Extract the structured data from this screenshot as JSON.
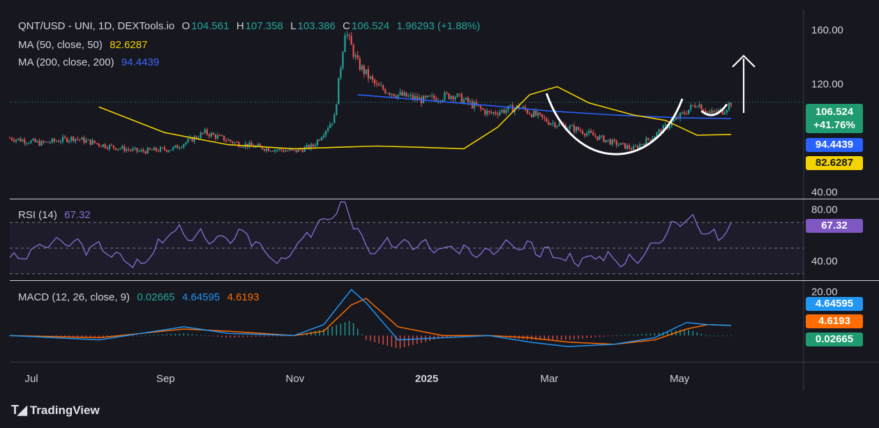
{
  "header": {
    "symbol": "QNT/USD - UNI, 1D, DEXTools.io",
    "o_label": "O",
    "o_value": "104.561",
    "h_label": "H",
    "h_value": "107.358",
    "l_label": "L",
    "l_value": "103.386",
    "c_label": "C",
    "c_value": "106.524",
    "change": "1.96293 (+1.88%)"
  },
  "ma50": {
    "label": "MA (50, close, 50)",
    "value": "82.6287",
    "color": "#f5d300"
  },
  "ma200": {
    "label": "MA (200, close, 200)",
    "value": "94.4439",
    "color": "#2962ff"
  },
  "rsi": {
    "label": "RSI (14)",
    "value": "67.32",
    "color": "#8b6fd6"
  },
  "macd": {
    "label": "MACD (12, 26, close, 9)",
    "hist_value": "0.02665",
    "macd_value": "4.64595",
    "signal_value": "4.6193"
  },
  "price_tags": {
    "price": "106.524",
    "price_change": "+41.76%",
    "ma200": "94.4439",
    "ma50": "82.6287"
  },
  "brand": "TradingView",
  "colors": {
    "background": "#16171f",
    "up": "#26a69a",
    "down": "#ef5350",
    "ma50": "#f5d300",
    "ma200": "#2962ff",
    "rsi": "#8b6fd6",
    "macd": "#2196f3",
    "signal": "#ff6d00"
  },
  "chart_data": [
    {
      "type": "line",
      "title": "QNT/USD - UNI, 1D, DEXTools.io",
      "x_ticks": [
        "Jul",
        "Sep",
        "Nov",
        "2025",
        "Mar",
        "May"
      ],
      "y_ticks": [
        "160.00",
        "120.00",
        "40.00"
      ],
      "ylim": [
        35,
        175
      ],
      "series": [
        {
          "name": "Close",
          "x": [
            "2024-06-20",
            "2024-07-05",
            "2024-07-20",
            "2024-08-05",
            "2024-08-20",
            "2024-09-05",
            "2024-09-20",
            "2024-10-05",
            "2024-10-20",
            "2024-11-01",
            "2024-11-10",
            "2024-11-20",
            "2024-11-25",
            "2024-12-01",
            "2024-12-10",
            "2024-12-20",
            "2025-01-01",
            "2025-01-15",
            "2025-02-01",
            "2025-02-15",
            "2025-03-01",
            "2025-03-15",
            "2025-04-01",
            "2025-04-10",
            "2025-04-20",
            "2025-05-01",
            "2025-05-10",
            "2025-05-16",
            "2025-05-22",
            "2025-05-26"
          ],
          "values": [
            80,
            76,
            80,
            74,
            70,
            72,
            84,
            76,
            72,
            70,
            74,
            95,
            160,
            135,
            118,
            112,
            108,
            112,
            98,
            103,
            92,
            86,
            76,
            72,
            82,
            95,
            106,
            98,
            100,
            106.5
          ]
        },
        {
          "name": "MA (50, close, 50)",
          "x": [
            "2024-08-01",
            "2024-09-01",
            "2024-10-01",
            "2024-11-01",
            "2024-11-20",
            "2024-12-10",
            "2025-01-01",
            "2025-01-20",
            "2025-02-05",
            "2025-02-20",
            "2025-03-05",
            "2025-03-20",
            "2025-04-10",
            "2025-04-25",
            "2025-05-10",
            "2025-05-26"
          ],
          "values": [
            103,
            84,
            75,
            72,
            73,
            74,
            73,
            72,
            88,
            112,
            118,
            106,
            97,
            93,
            82,
            82.6
          ]
        },
        {
          "name": "MA (200, close, 200)",
          "x": [
            "2024-12-01",
            "2025-01-01",
            "2025-02-01",
            "2025-03-01",
            "2025-04-01",
            "2025-05-01",
            "2025-05-26"
          ],
          "values": [
            112,
            108,
            104,
            100,
            97,
            95,
            94.4
          ]
        }
      ]
    },
    {
      "type": "line",
      "title": "RSI (14)",
      "y_ticks": [
        "80.00",
        "40.00"
      ],
      "ylim": [
        25,
        88
      ],
      "series": [
        {
          "name": "RSI (14)",
          "x": [
            "2024-06-20",
            "2024-07-10",
            "2024-08-01",
            "2024-08-20",
            "2024-09-05",
            "2024-09-25",
            "2024-10-10",
            "2024-10-25",
            "2024-11-10",
            "2024-11-20",
            "2024-11-25",
            "2024-12-05",
            "2024-12-20",
            "2025-01-10",
            "2025-02-01",
            "2025-02-20",
            "2025-03-10",
            "2025-03-25",
            "2025-04-10",
            "2025-04-25",
            "2025-05-05",
            "2025-05-15",
            "2025-05-20",
            "2025-05-26"
          ],
          "values": [
            40,
            55,
            50,
            35,
            65,
            55,
            60,
            38,
            65,
            78,
            85,
            50,
            55,
            50,
            48,
            52,
            40,
            45,
            38,
            62,
            75,
            60,
            58,
            67.32
          ]
        }
      ]
    },
    {
      "type": "line",
      "title": "MACD (12, 26, close, 9)",
      "y_ticks": [
        "20.00"
      ],
      "ylim": [
        -12,
        25
      ],
      "series": [
        {
          "name": "MACD",
          "x": [
            "2024-06-20",
            "2024-08-01",
            "2024-09-10",
            "2024-10-01",
            "2024-11-01",
            "2024-11-15",
            "2024-11-28",
            "2024-12-05",
            "2024-12-20",
            "2025-01-10",
            "2025-02-01",
            "2025-02-20",
            "2025-03-10",
            "2025-04-01",
            "2025-04-20",
            "2025-05-05",
            "2025-05-15",
            "2025-05-26"
          ],
          "values": [
            0,
            -2,
            4,
            1,
            0,
            5,
            21,
            15,
            -2,
            -1,
            0,
            -3,
            -5,
            -4,
            -1,
            6,
            5,
            4.64595
          ]
        },
        {
          "name": "Signal",
          "x": [
            "2024-06-20",
            "2024-08-01",
            "2024-09-10",
            "2024-10-01",
            "2024-11-01",
            "2024-11-15",
            "2024-11-28",
            "2024-12-05",
            "2024-12-20",
            "2025-01-10",
            "2025-02-01",
            "2025-02-20",
            "2025-03-10",
            "2025-04-01",
            "2025-04-20",
            "2025-05-05",
            "2025-05-15",
            "2025-05-26"
          ],
          "values": [
            0,
            -1,
            3,
            2,
            0,
            2,
            14,
            17,
            4,
            0,
            0,
            -1,
            -3,
            -4,
            -2,
            3,
            5,
            4.6193
          ]
        }
      ]
    }
  ]
}
